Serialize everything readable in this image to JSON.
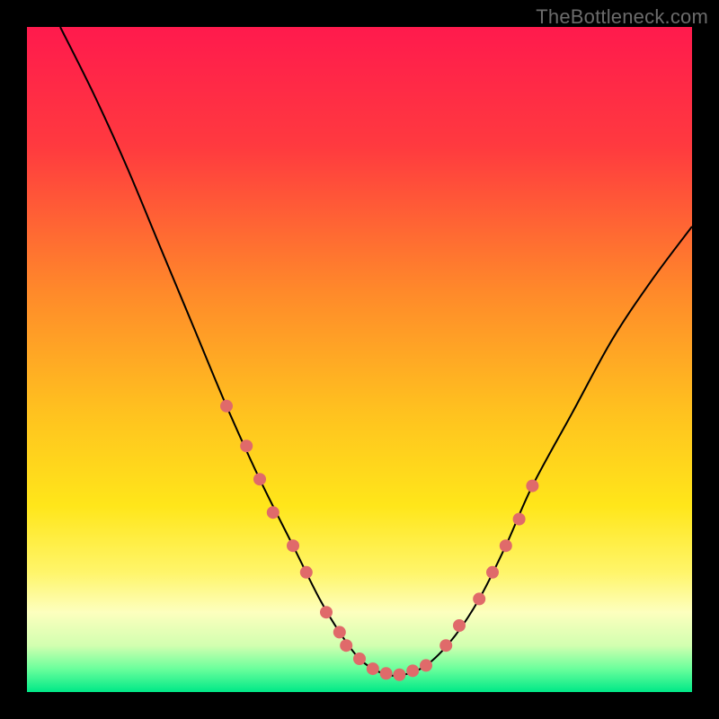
{
  "watermark": "TheBottleneck.com",
  "chart_data": {
    "type": "line",
    "title": "",
    "xlabel": "",
    "ylabel": "",
    "xlim": [
      0,
      100
    ],
    "ylim": [
      0,
      100
    ],
    "gradient_stops": [
      {
        "offset": 0.0,
        "color": "#ff1a4d"
      },
      {
        "offset": 0.18,
        "color": "#ff3a3f"
      },
      {
        "offset": 0.4,
        "color": "#ff8a2a"
      },
      {
        "offset": 0.58,
        "color": "#ffc21f"
      },
      {
        "offset": 0.72,
        "color": "#ffe61a"
      },
      {
        "offset": 0.82,
        "color": "#fff56a"
      },
      {
        "offset": 0.88,
        "color": "#fdffbe"
      },
      {
        "offset": 0.93,
        "color": "#d2ffb0"
      },
      {
        "offset": 0.965,
        "color": "#6bff9c"
      },
      {
        "offset": 1.0,
        "color": "#00e887"
      }
    ],
    "series": [
      {
        "name": "bottleneck-curve",
        "x": [
          5,
          10,
          15,
          20,
          25,
          30,
          35,
          40,
          44,
          47,
          50,
          53,
          56,
          60,
          64,
          68,
          72,
          76,
          82,
          88,
          94,
          100
        ],
        "y": [
          100,
          90,
          79,
          67,
          55,
          43,
          32,
          22,
          14,
          9,
          5,
          3,
          2.5,
          4,
          8,
          14,
          22,
          31,
          42,
          53,
          62,
          70
        ]
      }
    ],
    "markers": {
      "name": "highlight-dots",
      "color": "#e06a6a",
      "points": [
        {
          "x": 30,
          "y": 43
        },
        {
          "x": 33,
          "y": 37
        },
        {
          "x": 35,
          "y": 32
        },
        {
          "x": 37,
          "y": 27
        },
        {
          "x": 40,
          "y": 22
        },
        {
          "x": 42,
          "y": 18
        },
        {
          "x": 45,
          "y": 12
        },
        {
          "x": 47,
          "y": 9
        },
        {
          "x": 48,
          "y": 7
        },
        {
          "x": 50,
          "y": 5
        },
        {
          "x": 52,
          "y": 3.5
        },
        {
          "x": 54,
          "y": 2.8
        },
        {
          "x": 56,
          "y": 2.6
        },
        {
          "x": 58,
          "y": 3.2
        },
        {
          "x": 60,
          "y": 4
        },
        {
          "x": 63,
          "y": 7
        },
        {
          "x": 65,
          "y": 10
        },
        {
          "x": 68,
          "y": 14
        },
        {
          "x": 70,
          "y": 18
        },
        {
          "x": 72,
          "y": 22
        },
        {
          "x": 74,
          "y": 26
        },
        {
          "x": 76,
          "y": 31
        }
      ]
    }
  }
}
